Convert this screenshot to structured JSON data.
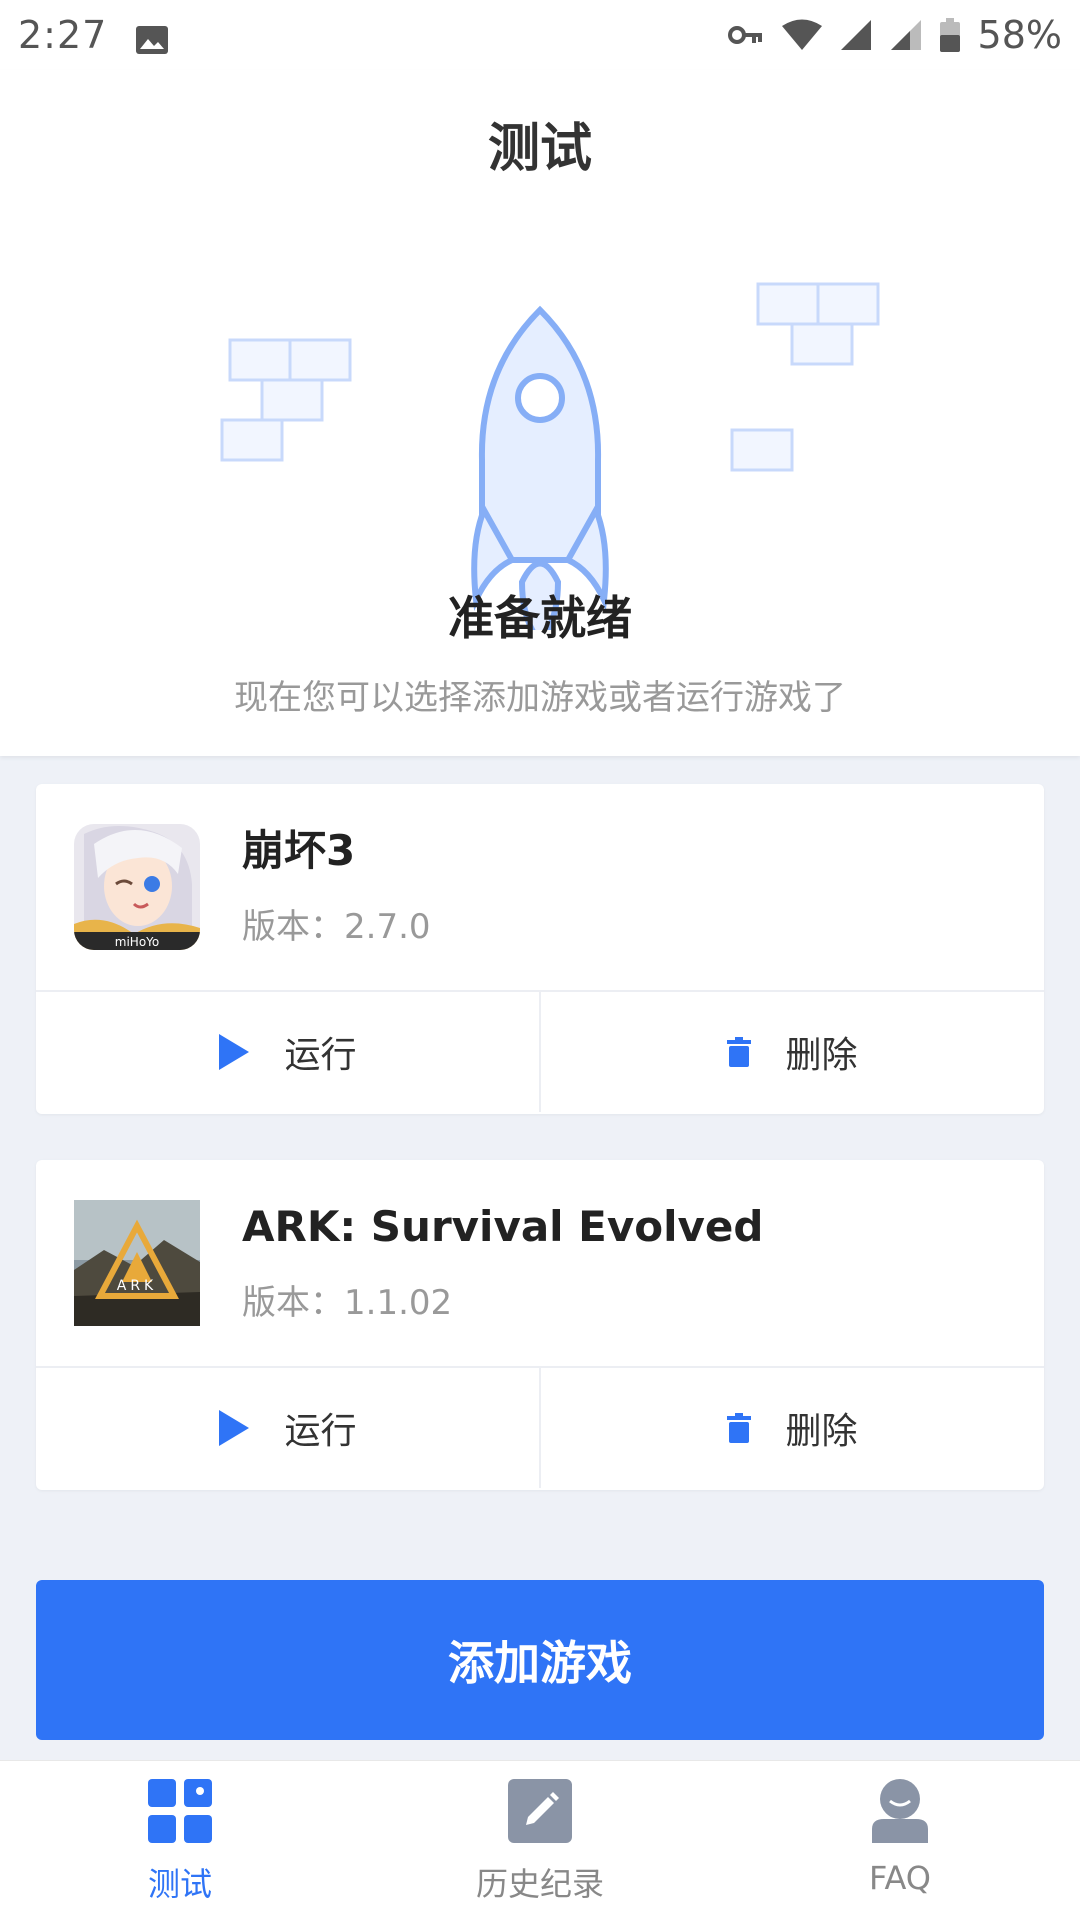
{
  "status_bar": {
    "time": "2:27",
    "battery": "58%",
    "icons": [
      "gallery-icon",
      "key-icon",
      "wifi-icon",
      "signal-icon",
      "signal-icon",
      "battery-icon"
    ]
  },
  "header": {
    "title": "测试"
  },
  "hero": {
    "ready_title": "准备就绪",
    "ready_subtitle": "现在您可以选择添加游戏或者运行游戏了"
  },
  "games": [
    {
      "name": "崩坏3",
      "version": "版本：2.7.0",
      "run_label": "运行",
      "delete_label": "删除"
    },
    {
      "name": "ARK: Survival Evolved",
      "version": "版本：1.1.02",
      "run_label": "运行",
      "delete_label": "删除"
    }
  ],
  "add_game_label": "添加游戏",
  "bottom_nav": {
    "items": [
      {
        "label": "测试",
        "icon": "dashboard-grid-icon",
        "active": true
      },
      {
        "label": "历史纪录",
        "icon": "edit-pencil-icon",
        "active": false
      },
      {
        "label": "FAQ",
        "icon": "user-profile-icon",
        "active": false
      }
    ]
  },
  "colors": {
    "accent": "#2f74f6",
    "background": "#eef1f7",
    "muted_text": "#999999"
  }
}
